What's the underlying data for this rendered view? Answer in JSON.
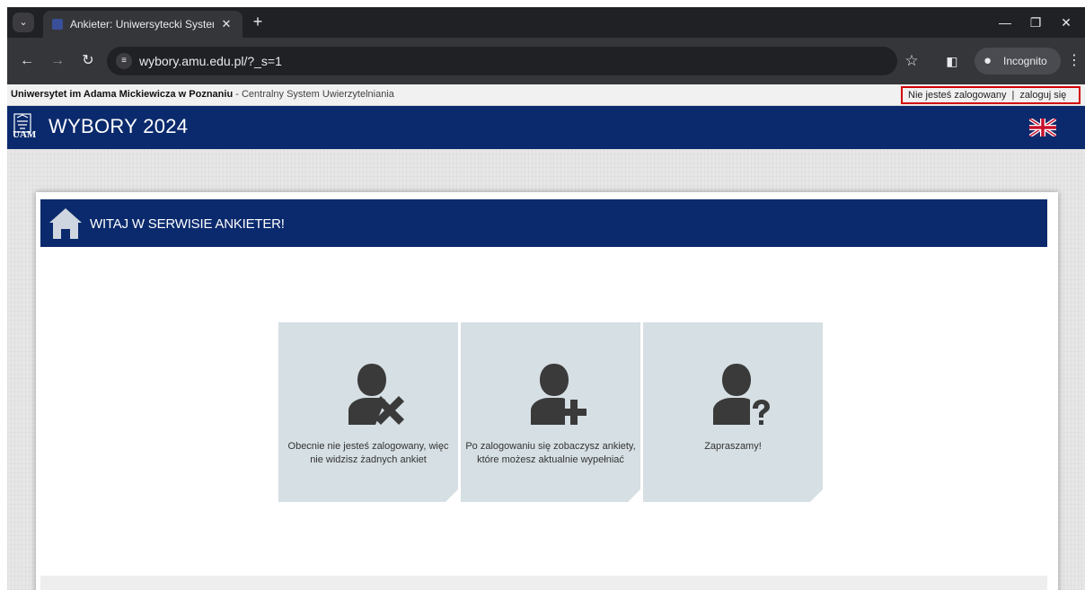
{
  "browser": {
    "tab_title": "Ankieter: Uniwersytecki System",
    "url": "wybory.amu.edu.pl/?_s=1",
    "incognito_label": "Incognito"
  },
  "topbar": {
    "university": "Uniwersytet im Adama Mickiewicza w Poznaniu",
    "dash": " - ",
    "system": "Centralny System Uwierzytelniania",
    "not_logged": "Nie jesteś zalogowany",
    "separator": "|",
    "login_link": "zaloguj się"
  },
  "banner": {
    "logo_text": "UAM",
    "title": "WYBORY 2024"
  },
  "main": {
    "header_title": "WITAJ W SERWISIE ANKIETER!",
    "tiles": [
      {
        "text": "Obecnie nie jesteś zalogowany, więc nie widzisz żadnych ankiet"
      },
      {
        "text": "Po zalogowaniu się zobaczysz ankiety, które możesz aktualnie wypełniać"
      },
      {
        "text": "Zapraszamy!"
      }
    ]
  },
  "colors": {
    "navy": "#0b2a6d",
    "tile_bg": "#d6dfe3",
    "icon": "#3a3a3a",
    "highlight": "#d40000"
  },
  "icons": {
    "tabs": "chevron-down-icon",
    "close": "close-icon",
    "new_tab": "plus-icon",
    "back": "back-arrow-icon",
    "forward": "forward-arrow-icon",
    "reload": "reload-icon",
    "site_settings": "tune-icon",
    "bookmark": "star-icon",
    "side_panel": "side-panel-icon",
    "incognito": "incognito-icon",
    "menu": "kebab-menu-icon",
    "flag": "uk-flag-icon",
    "home": "home-icon"
  }
}
